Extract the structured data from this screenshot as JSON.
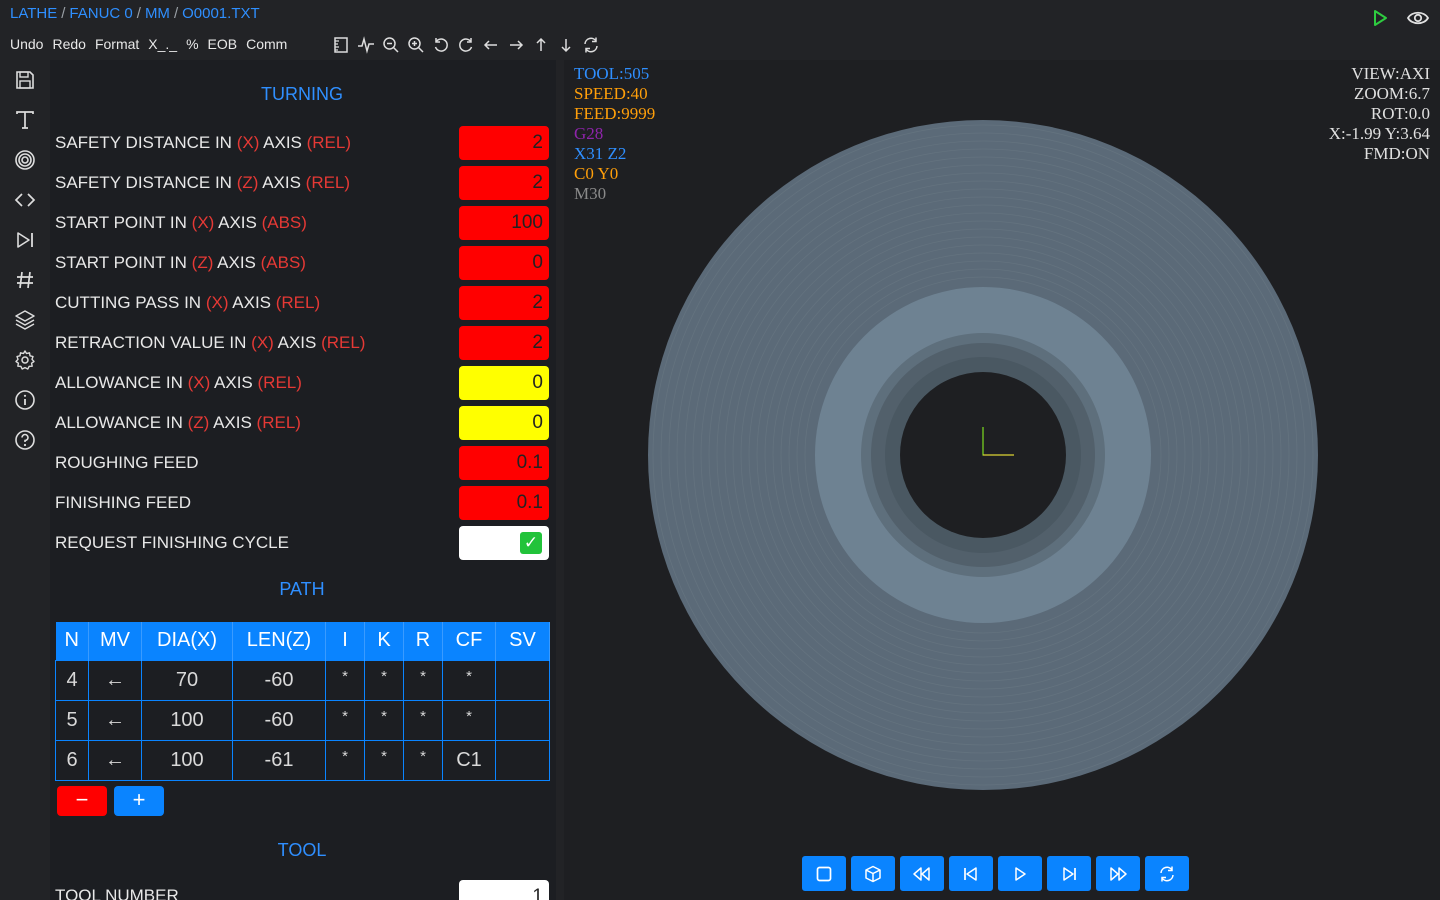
{
  "breadcrumb": [
    "LATHE",
    "FANUC 0",
    "MM",
    "O0001.TXT"
  ],
  "menu": [
    "Undo",
    "Redo",
    "Format",
    "X_._",
    "%",
    "EOB",
    "Comm"
  ],
  "toolbar_icons": [
    "ruler-icon",
    "waveform-icon",
    "zoom-out-icon",
    "zoom-in-icon",
    "rotate-left-icon",
    "rotate-right-icon",
    "arrow-left-icon",
    "arrow-right-icon",
    "arrow-up-icon",
    "arrow-down-icon",
    "refresh-icon"
  ],
  "sidebar_icons": [
    "save-icon",
    "text-icon",
    "target-icon",
    "code-icon",
    "skip-forward-icon",
    "hash-icon",
    "layers-icon",
    "gear-icon",
    "info-icon",
    "help-icon"
  ],
  "sections": {
    "turning": "TURNING",
    "path": "PATH",
    "tool": "TOOL"
  },
  "turning_fields": [
    {
      "parts": [
        "SAFETY DISTANCE IN ",
        "(X)",
        " AXIS ",
        "(REL)"
      ],
      "value": "2",
      "color": "red"
    },
    {
      "parts": [
        "SAFETY DISTANCE IN ",
        "(Z)",
        " AXIS ",
        "(REL)"
      ],
      "value": "2",
      "color": "red"
    },
    {
      "parts": [
        "START POINT IN ",
        "(X)",
        " AXIS ",
        "(ABS)"
      ],
      "value": "100",
      "color": "red"
    },
    {
      "parts": [
        "START POINT IN ",
        "(Z)",
        " AXIS ",
        "(ABS)"
      ],
      "value": "0",
      "color": "red"
    },
    {
      "parts": [
        "CUTTING PASS IN ",
        "(X)",
        " AXIS ",
        "(REL)"
      ],
      "value": "2",
      "color": "red"
    },
    {
      "parts": [
        "RETRACTION VALUE IN ",
        "(X)",
        " AXIS ",
        "(REL)"
      ],
      "value": "2",
      "color": "red"
    },
    {
      "parts": [
        "ALLOWANCE IN ",
        "(X)",
        " AXIS ",
        "(REL)"
      ],
      "value": "0",
      "color": "yellow"
    },
    {
      "parts": [
        "ALLOWANCE IN ",
        "(Z)",
        " AXIS ",
        "(REL)"
      ],
      "value": "0",
      "color": "yellow"
    },
    {
      "parts": [
        "ROUGHING FEED"
      ],
      "value": "0.1",
      "color": "red"
    },
    {
      "parts": [
        "FINISHING FEED"
      ],
      "value": "0.1",
      "color": "red"
    }
  ],
  "finishing_cycle": {
    "label": "REQUEST FINISHING CYCLE",
    "checked": true,
    "check_glyph": "✓"
  },
  "path_table": {
    "headers": [
      "N",
      "MV",
      "DIA(X)",
      "LEN(Z)",
      "I",
      "K",
      "R",
      "CF",
      "SV"
    ],
    "rows": [
      [
        "4",
        "←",
        "70",
        "-60",
        "*",
        "*",
        "*",
        "*",
        ""
      ],
      [
        "5",
        "←",
        "100",
        "-60",
        "*",
        "*",
        "*",
        "*",
        ""
      ],
      [
        "6",
        "←",
        "100",
        "-61",
        "*",
        "*",
        "*",
        "C1",
        ""
      ]
    ]
  },
  "path_buttons": {
    "remove": "−",
    "add": "+"
  },
  "tool_fields": [
    {
      "label": "TOOL NUMBER",
      "value": "1"
    }
  ],
  "viewer": {
    "info_left": [
      {
        "text": "TOOL:505",
        "color": "#2f8fff"
      },
      {
        "text": "SPEED:40",
        "color": "#ff9f0a"
      },
      {
        "text": "FEED:9999",
        "color": "#ff9f0a"
      },
      {
        "text": "G28",
        "color": "#8e24aa"
      },
      {
        "text": "X31 Z2",
        "color": "#2f8fff"
      },
      {
        "text": "C0 Y0",
        "color": "#ff9f0a"
      },
      {
        "text": "M30",
        "color": "#8a8a8a"
      }
    ],
    "info_right": [
      "VIEW:AXI",
      "ZOOM:6.7",
      "ROT:0.0",
      "X:-1.99 Y:3.64",
      "FMD:ON"
    ],
    "controls": [
      "stop-icon",
      "cube-icon",
      "rewind-icon",
      "skip-back-icon",
      "play-icon",
      "skip-forward-icon",
      "fast-forward-icon",
      "refresh-icon"
    ]
  },
  "colors": {
    "accent": "#0a84ff",
    "field_red": "#ff0000",
    "field_yellow": "#ffff00",
    "part_outer": "#5b6a78",
    "part_inner": "#6e8292"
  }
}
